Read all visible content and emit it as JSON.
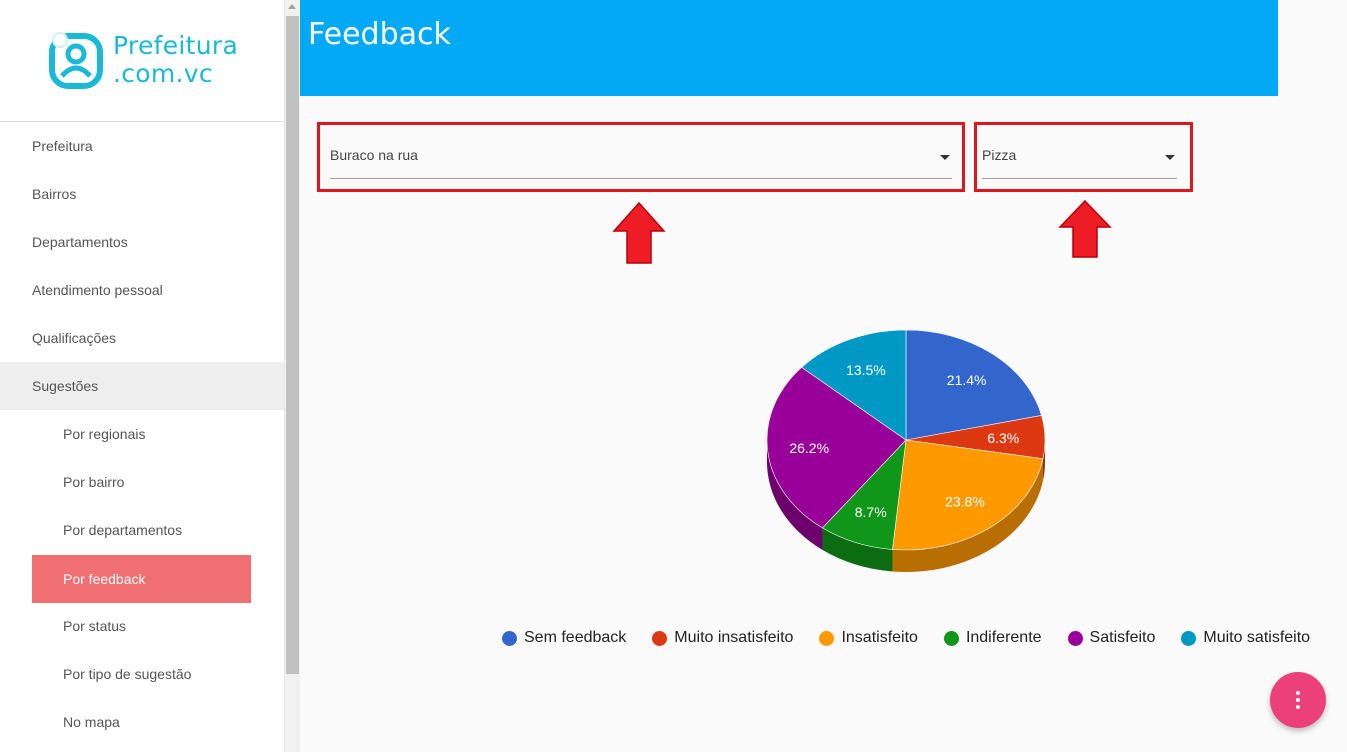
{
  "logo": {
    "line1": "Prefeitura",
    "line2": ".com.vc"
  },
  "header": {
    "title": "Feedback"
  },
  "sidebar": {
    "items": [
      {
        "label": "Prefeitura"
      },
      {
        "label": "Bairros"
      },
      {
        "label": "Departamentos"
      },
      {
        "label": "Atendimento pessoal"
      },
      {
        "label": "Qualificações"
      },
      {
        "label": "Sugestões"
      }
    ],
    "subitems": [
      {
        "label": "Por regionais"
      },
      {
        "label": "Por bairro"
      },
      {
        "label": "Por departamentos"
      },
      {
        "label": "Por feedback"
      },
      {
        "label": "Por status"
      },
      {
        "label": "Por tipo de sugestão"
      },
      {
        "label": "No mapa"
      }
    ],
    "expanded_item": "Sugestões",
    "active_subitem": "Por feedback"
  },
  "filters": {
    "category_value": "Buraco na rua",
    "chart_type_value": "Pizza"
  },
  "colors": {
    "header": "#03a9f4",
    "active_item": "#ef6f73",
    "highlight": "#e0161f",
    "fab": "#ec407a"
  },
  "chart_data": {
    "type": "pie",
    "style": "3d",
    "categories": [
      "Sem feedback",
      "Muito insatisfeito",
      "Insatisfeito",
      "Indiferente",
      "Satisfeito",
      "Muito satisfeito"
    ],
    "values": [
      21.4,
      6.3,
      23.8,
      8.7,
      26.2,
      13.5
    ],
    "labels": [
      "21.4%",
      "6.3%",
      "23.8%",
      "8.7%",
      "26.2%",
      "13.5%"
    ],
    "colors": [
      "#3366cc",
      "#dc3912",
      "#ff9900",
      "#109618",
      "#990099",
      "#0099c6"
    ],
    "legend_position": "bottom"
  }
}
